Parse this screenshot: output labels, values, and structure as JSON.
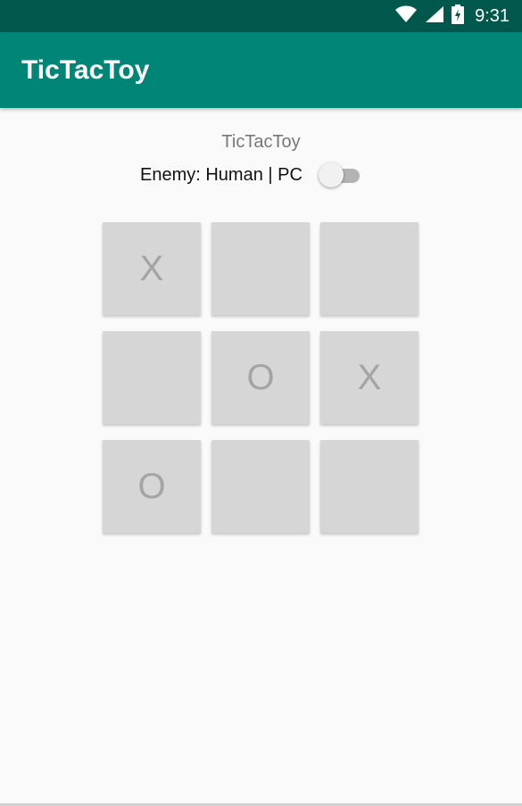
{
  "status_bar": {
    "time": "9:31",
    "icons": [
      "wifi-icon",
      "cell-signal-icon",
      "battery-charging-icon"
    ],
    "background": "#00574b"
  },
  "app_bar": {
    "title": "TicTacToy",
    "background": "#008577"
  },
  "main": {
    "subtitle": "TicTacToy",
    "enemy_label": "Enemy: Human | PC",
    "enemy_toggle_on": false
  },
  "board": {
    "cells": [
      [
        "X",
        "",
        ""
      ],
      [
        "",
        "O",
        "X"
      ],
      [
        "O",
        "",
        ""
      ]
    ],
    "cell_color": "#d6d6d6",
    "mark_color": "#a4a4a4"
  }
}
